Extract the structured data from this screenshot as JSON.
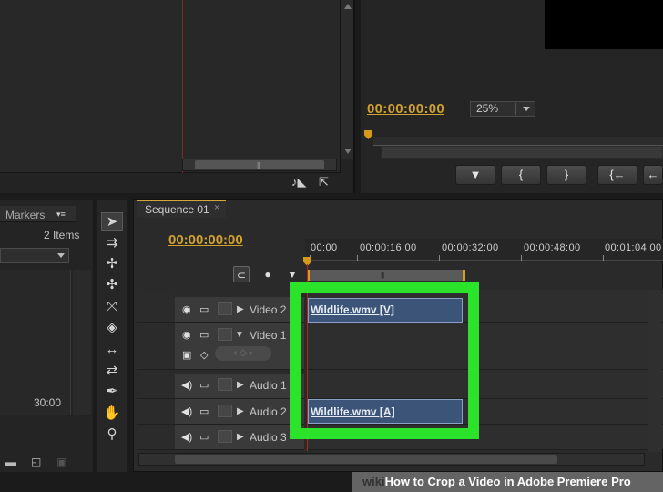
{
  "source_monitor": {
    "footer_icons": [
      "audio-sync-icon",
      "export-frame-icon"
    ]
  },
  "program_monitor": {
    "timecode": "00:00:00:00",
    "zoom": "25%",
    "transport_buttons": [
      "▼",
      "{",
      "}",
      "{←",
      "←"
    ]
  },
  "markers_panel": {
    "tab_label": "Markers",
    "menu_glyph": "▾≡",
    "items_count": "2 Items",
    "duration": "30:00"
  },
  "tools": [
    "selection-tool-icon",
    "track-select-tool-icon",
    "ripple-edit-tool-icon",
    "rolling-edit-tool-icon",
    "rate-stretch-tool-icon",
    "razor-tool-icon",
    "slip-tool-icon",
    "slide-tool-icon",
    "pen-tool-icon",
    "hand-tool-icon",
    "zoom-tool-icon"
  ],
  "timeline": {
    "tab_label": "Sequence 01",
    "tab_close": "×",
    "timecode": "00:00:00:00",
    "ruler_labels": [
      "00:00",
      "00:00:16:00",
      "00:00:32:00",
      "00:00:48:00",
      "00:01:04:00"
    ],
    "tracks": {
      "video2": "Video 2",
      "video1": "Video 1",
      "audio1": "Audio 1",
      "audio2": "Audio 2",
      "audio3": "Audio 3"
    },
    "clips": {
      "video": "Wildlife.wmv [V]",
      "audio": "Wildlife.wmv [A]"
    }
  },
  "caption": {
    "wiki": "wiki",
    "text": "How to Crop a Video in Adobe Premiere Pro"
  },
  "colors": {
    "timecode": "#d1a12e",
    "highlight": "#2be32b",
    "clip": "#3c5477",
    "playhead": "#b3271b"
  }
}
